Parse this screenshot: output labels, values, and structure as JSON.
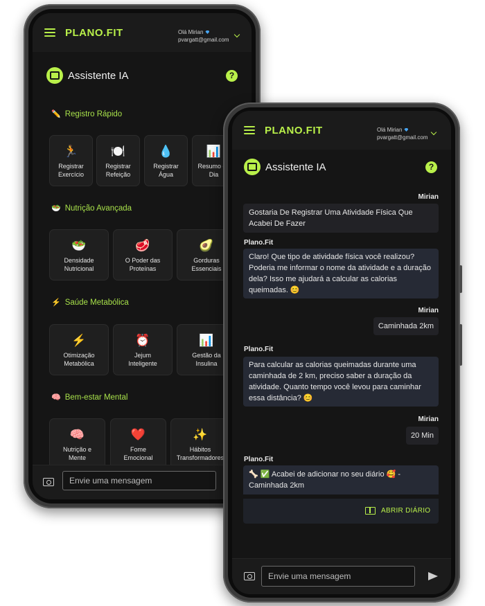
{
  "brand": {
    "logo": "PLANO.FIT",
    "accent": "#b9f04a"
  },
  "user": {
    "greeting": "Olá Mirian",
    "email": "pvargatt@gmail.com"
  },
  "assistant": {
    "title": "Assistente IA",
    "help": "?"
  },
  "left_screen": {
    "sections": [
      {
        "title": "Registro Rápido",
        "emoji": "✏️",
        "cards": [
          {
            "emoji": "🏃",
            "label": "Registrar\nExercício"
          },
          {
            "emoji": "🍽️",
            "label": "Registrar\nRefeição"
          },
          {
            "emoji": "💧",
            "label": "Registrar\nÁgua"
          },
          {
            "emoji": "📊",
            "label": "Resumo do\nDia"
          }
        ]
      },
      {
        "title": "Nutrição Avançada",
        "emoji": "🥗",
        "cards": [
          {
            "emoji": "🥗",
            "label": "Densidade\nNutricional"
          },
          {
            "emoji": "🥩",
            "label": "O Poder das\nProteínas"
          },
          {
            "emoji": "🥑",
            "label": "Gorduras\nEssenciais"
          }
        ]
      },
      {
        "title": "Saúde Metabólica",
        "emoji": "⚡",
        "cards": [
          {
            "emoji": "⚡",
            "label": "Otimização\nMetabólica"
          },
          {
            "emoji": "⏰",
            "label": "Jejum\nInteligente"
          },
          {
            "emoji": "📊",
            "label": "Gestão da\nInsulina"
          }
        ]
      },
      {
        "title": "Bem-estar Mental",
        "emoji": "🧠",
        "cards": [
          {
            "emoji": "🧠",
            "label": "Nutrição e\nMente"
          },
          {
            "emoji": "❤️",
            "label": "Fome\nEmocional"
          },
          {
            "emoji": "✨",
            "label": "Hábitos\nTransformadores"
          }
        ]
      }
    ],
    "input_placeholder": "Envie uma mensagem"
  },
  "right_screen": {
    "messages": [
      {
        "sender": "Mirian",
        "text": "Gostaria De Registrar Uma Atividade Física Que Acabei De Fazer"
      },
      {
        "sender": "Plano.Fit",
        "text": "Claro! Que tipo de atividade física você realizou? Poderia me informar o nome da atividade e a duração dela? Isso me ajudará a calcular as calorias queimadas. 😊"
      },
      {
        "sender": "Mirian",
        "text": "Caminhada 2km"
      },
      {
        "sender": "Plano.Fit",
        "text": "Para calcular as calorias queimadas durante uma caminhada de 2 km, preciso saber a duração da atividade. Quanto tempo você levou para caminhar essa distância? 😊"
      },
      {
        "sender": "Mirian",
        "text": "20 Min"
      },
      {
        "sender": "Plano.Fit",
        "text": "🦴 ✅ Acabei de adicionar no seu diário 🥰 - Caminhada 2km"
      }
    ],
    "diary_button": "ABRIR DIÁRIO",
    "input_placeholder": "Envie uma mensagem"
  }
}
